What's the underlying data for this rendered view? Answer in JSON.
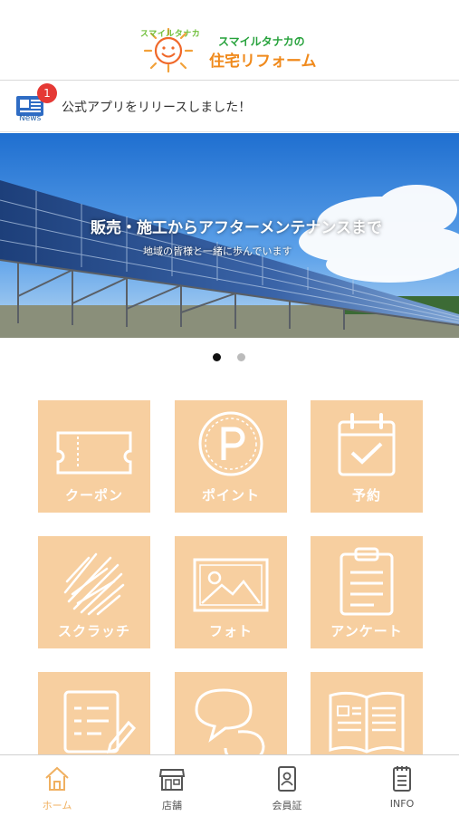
{
  "header": {
    "logo_small_text": "スマイルタナカ",
    "logo_line1": "スマイルタナカの",
    "logo_line2": "住宅リフォーム",
    "accent_green": "#27a23c",
    "accent_orange": "#f08a1c"
  },
  "news": {
    "icon": "newspaper-icon",
    "badge_count": "1",
    "icon_label": "News",
    "message": "公式アプリをリリースしました！"
  },
  "banner": {
    "image": "solar-panels-photo",
    "title": "販売・施工からアフターメンテナンスまで",
    "subtitle": "地域の皆様と一緒に歩んでいます",
    "active_slide": 1,
    "slide_count": 2
  },
  "menu": {
    "tile_color": "#f7cfa0",
    "items": [
      {
        "label": "クーポン",
        "icon": "ticket-icon"
      },
      {
        "label": "ポイント",
        "icon": "points-p-icon"
      },
      {
        "label": "予約",
        "icon": "calendar-check-icon"
      },
      {
        "label": "スクラッチ",
        "icon": "scratch-icon"
      },
      {
        "label": "フォト",
        "icon": "photo-icon"
      },
      {
        "label": "アンケート",
        "icon": "clipboard-survey-icon"
      },
      {
        "label": "",
        "icon": "form-edit-icon"
      },
      {
        "label": "",
        "icon": "chat-bubbles-icon"
      },
      {
        "label": "",
        "icon": "magazine-icon"
      }
    ]
  },
  "tabbar": {
    "active_color": "#f0b060",
    "items": [
      {
        "label": "ホーム",
        "icon": "home-icon",
        "active": true
      },
      {
        "label": "店舗",
        "icon": "store-icon",
        "active": false
      },
      {
        "label": "会員証",
        "icon": "member-card-icon",
        "active": false
      },
      {
        "label": "INFO",
        "icon": "info-document-icon",
        "active": false
      }
    ]
  }
}
